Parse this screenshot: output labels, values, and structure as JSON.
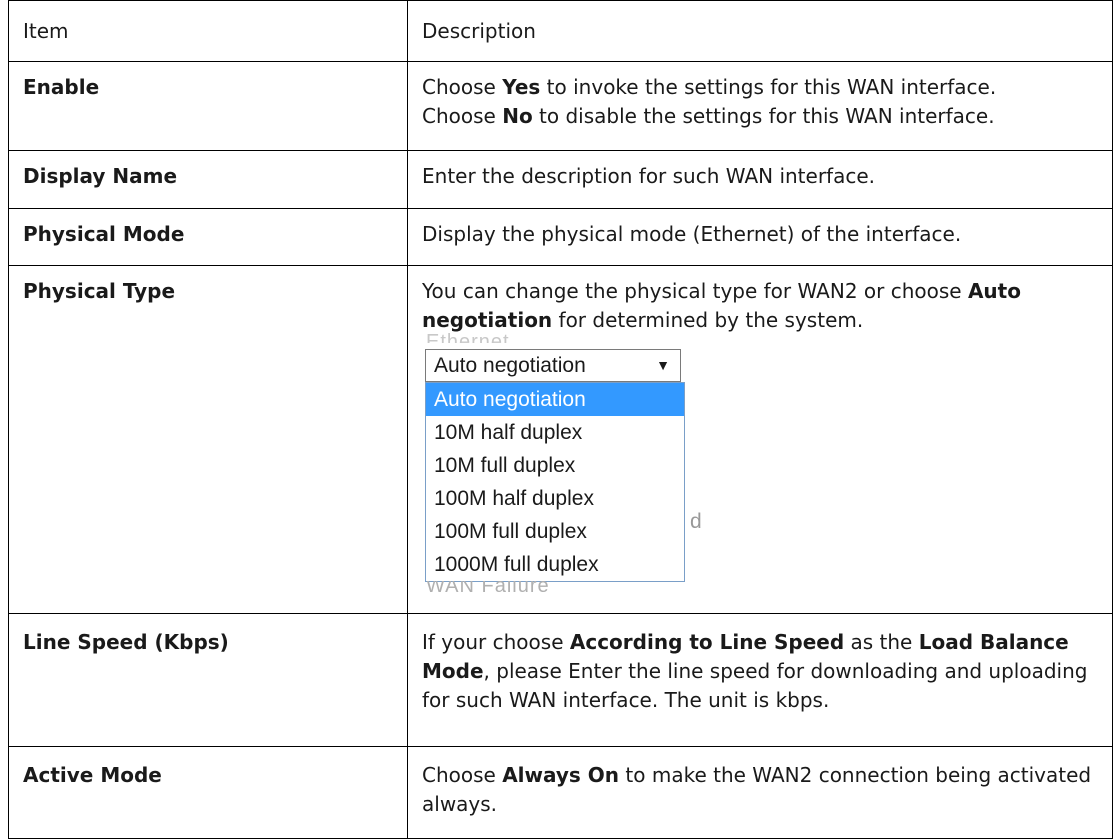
{
  "header": {
    "item": "Item",
    "description": "Description"
  },
  "rows": {
    "enable": {
      "item": "Enable",
      "l1_a": "Choose ",
      "l1_b": "Yes",
      "l1_c": " to invoke the settings for this WAN interface.",
      "l2_a": "Choose ",
      "l2_b": "No",
      "l2_c": " to disable the settings for this WAN interface."
    },
    "display_name": {
      "item": "Display Name",
      "desc": "Enter the description for such WAN interface."
    },
    "physical_mode": {
      "item": "Physical Mode",
      "desc": "Display the physical mode (Ethernet) of the interface."
    },
    "physical_type": {
      "item": "Physical Type",
      "d_a": "You can change the physical type for WAN2 or choose ",
      "d_b": "Auto negotiation",
      "d_c": " for determined by the system.",
      "shot": {
        "ghost_top": "Ethernet",
        "selected": "Auto negotiation",
        "options": [
          "Auto negotiation",
          "10M half duplex",
          "10M full duplex",
          "100M half duplex",
          "100M full duplex",
          "1000M full duplex"
        ],
        "ghost_right": "d",
        "ghost_bottom": "WAN Failure"
      }
    },
    "line_speed": {
      "item": "Line Speed (Kbps)",
      "a": "If your choose ",
      "b": "According to Line Speed",
      "c": " as the ",
      "d": "Load Balance Mode",
      "e": ", please Enter the line speed for downloading and uploading for such WAN interface. The unit is kbps."
    },
    "active_mode": {
      "item": "Active Mode",
      "a": "Choose ",
      "b": "Always On",
      "c": " to make the WAN2 connection being activated always."
    }
  }
}
